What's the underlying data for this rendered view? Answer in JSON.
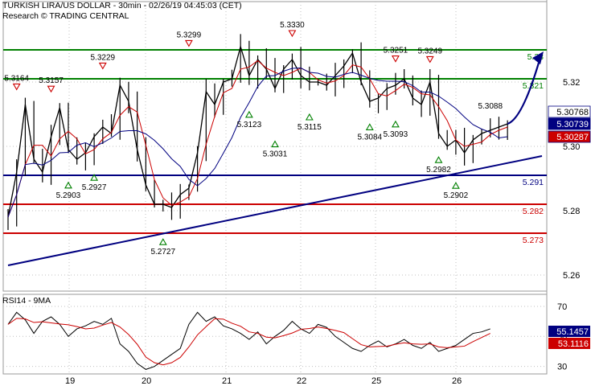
{
  "header": {
    "line1": "TURKISH LIRA/US DOLLAR - 30min - 02/26/19 04:45:03 (CET)",
    "line2": "Research © TRADING CENTRAL"
  },
  "chart_data": [
    {
      "type": "line",
      "title": "TURKISH LIRA/US DOLLAR - 30min",
      "x_ticks": [
        "19",
        "20",
        "21",
        "22",
        "25",
        "26"
      ],
      "ylim": [
        5.255,
        5.345
      ],
      "y_ticks": [
        "5.26",
        "5.28",
        "5.30",
        "5.32"
      ],
      "grid": true,
      "series_points": [
        [
          0,
          5.278
        ],
        [
          1,
          5.292
        ],
        [
          2,
          5.313
        ],
        [
          3,
          5.296
        ],
        [
          4,
          5.292
        ],
        [
          5,
          5.303
        ],
        [
          6,
          5.312
        ],
        [
          7,
          5.299
        ],
        [
          8,
          5.296
        ],
        [
          9,
          5.298
        ],
        [
          10,
          5.303
        ],
        [
          11,
          5.306
        ],
        [
          12,
          5.304
        ],
        [
          13,
          5.319
        ],
        [
          14,
          5.314
        ],
        [
          15,
          5.299
        ],
        [
          16,
          5.288
        ],
        [
          17,
          5.282
        ],
        [
          18,
          5.282
        ],
        [
          19,
          5.281
        ],
        [
          20,
          5.285
        ],
        [
          21,
          5.287
        ],
        [
          22,
          5.298
        ],
        [
          23,
          5.317
        ],
        [
          24,
          5.313
        ],
        [
          25,
          5.32
        ],
        [
          26,
          5.321
        ],
        [
          27,
          5.331
        ],
        [
          28,
          5.322
        ],
        [
          29,
          5.327
        ],
        [
          30,
          5.324
        ],
        [
          31,
          5.318
        ],
        [
          32,
          5.324
        ],
        [
          33,
          5.327
        ],
        [
          34,
          5.322
        ],
        [
          35,
          5.32
        ],
        [
          36,
          5.32
        ],
        [
          37,
          5.319
        ],
        [
          38,
          5.322
        ],
        [
          39,
          5.325
        ],
        [
          40,
          5.329
        ],
        [
          41,
          5.32
        ],
        [
          42,
          5.314
        ],
        [
          43,
          5.315
        ],
        [
          44,
          5.318
        ],
        [
          45,
          5.319
        ],
        [
          46,
          5.321
        ],
        [
          47,
          5.315
        ],
        [
          48,
          5.313
        ],
        [
          49,
          5.32
        ],
        [
          50,
          5.304
        ],
        [
          51,
          5.3
        ],
        [
          52,
          5.302
        ],
        [
          53,
          5.298
        ],
        [
          54,
          5.302
        ],
        [
          55,
          5.304
        ],
        [
          56,
          5.305
        ],
        [
          57,
          5.306
        ],
        [
          58,
          5.307
        ]
      ],
      "moving_averages": [
        "red",
        "navy"
      ],
      "levels": [
        {
          "label": "5.33",
          "value": 5.33,
          "color": "#008000"
        },
        {
          "label": "5.321",
          "value": 5.321,
          "color": "#008000"
        },
        {
          "label": "5.291",
          "value": 5.291,
          "color": "#000080"
        },
        {
          "label": "5.282",
          "value": 5.282,
          "color": "#cc0000"
        },
        {
          "label": "5.273",
          "value": 5.273,
          "color": "#cc0000"
        }
      ],
      "trendline": {
        "from": [
          0,
          5.263
        ],
        "to": [
          62,
          5.297
        ],
        "color": "#000080"
      },
      "forecast_arrow": {
        "from": [
          58,
          5.307
        ],
        "to": [
          62,
          5.329
        ],
        "color": "#000080"
      },
      "price_tags": [
        {
          "label": "5.30768",
          "value": 5.3077,
          "bg": "#ffffff",
          "fg": "#000000"
        },
        {
          "label": "5.30739",
          "value": 5.3074,
          "bg": "#000080",
          "fg": "#ffffff"
        },
        {
          "label": "5.30287",
          "value": 5.3029,
          "bg": "#cc0000",
          "fg": "#ffffff"
        }
      ],
      "peaks": [
        {
          "label": "5.3164",
          "x": 1,
          "y": 5.3164
        },
        {
          "label": "5.3157",
          "x": 5,
          "y": 5.3157
        },
        {
          "label": "5.3229",
          "x": 11,
          "y": 5.3229
        },
        {
          "label": "5.3299",
          "x": 21,
          "y": 5.3299
        },
        {
          "label": "5.3330",
          "x": 33,
          "y": 5.333
        },
        {
          "label": "5.3251",
          "x": 45,
          "y": 5.3251
        },
        {
          "label": "5.3249",
          "x": 49,
          "y": 5.3249
        }
      ],
      "troughs": [
        {
          "label": "5.2903",
          "x": 7,
          "y": 5.2903
        },
        {
          "label": "5.2927",
          "x": 10,
          "y": 5.2927
        },
        {
          "label": "5.2727",
          "x": 18,
          "y": 5.2727
        },
        {
          "label": "5.3123",
          "x": 28,
          "y": 5.3123
        },
        {
          "label": "5.3031",
          "x": 31,
          "y": 5.3031
        },
        {
          "label": "5.3115",
          "x": 35,
          "y": 5.3115
        },
        {
          "label": "5.3084",
          "x": 42,
          "y": 5.3084
        },
        {
          "label": "5.3093",
          "x": 45,
          "y": 5.3093
        },
        {
          "label": "5.2982",
          "x": 50,
          "y": 5.2982
        },
        {
          "label": "5.2902",
          "x": 52,
          "y": 5.2902
        }
      ],
      "target_label": {
        "label": "5.3088",
        "x": 56,
        "y": 5.3088
      }
    },
    {
      "type": "line",
      "title": "RSI14 - 9MA",
      "ylim": [
        25,
        78
      ],
      "y_ticks": [
        "30",
        "50",
        "70"
      ],
      "series_points": [
        [
          0,
          58
        ],
        [
          1,
          66
        ],
        [
          2,
          61
        ],
        [
          3,
          52
        ],
        [
          4,
          60
        ],
        [
          5,
          63
        ],
        [
          6,
          58
        ],
        [
          7,
          50
        ],
        [
          8,
          55
        ],
        [
          9,
          57
        ],
        [
          10,
          60
        ],
        [
          11,
          58
        ],
        [
          12,
          62
        ],
        [
          13,
          45
        ],
        [
          14,
          40
        ],
        [
          15,
          32
        ],
        [
          16,
          28
        ],
        [
          17,
          30
        ],
        [
          18,
          34
        ],
        [
          19,
          38
        ],
        [
          20,
          42
        ],
        [
          21,
          58
        ],
        [
          22,
          66
        ],
        [
          23,
          60
        ],
        [
          24,
          63
        ],
        [
          25,
          57
        ],
        [
          26,
          55
        ],
        [
          27,
          52
        ],
        [
          28,
          48
        ],
        [
          29,
          53
        ],
        [
          30,
          45
        ],
        [
          31,
          50
        ],
        [
          32,
          54
        ],
        [
          33,
          60
        ],
        [
          34,
          55
        ],
        [
          35,
          52
        ],
        [
          36,
          58
        ],
        [
          37,
          56
        ],
        [
          38,
          50
        ],
        [
          39,
          46
        ],
        [
          40,
          42
        ],
        [
          41,
          40
        ],
        [
          42,
          44
        ],
        [
          43,
          47
        ],
        [
          44,
          43
        ],
        [
          45,
          45
        ],
        [
          46,
          48
        ],
        [
          47,
          44
        ],
        [
          48,
          42
        ],
        [
          49,
          46
        ],
        [
          50,
          40
        ],
        [
          51,
          42
        ],
        [
          52,
          44
        ],
        [
          53,
          48
        ],
        [
          54,
          52
        ],
        [
          55,
          53
        ],
        [
          56,
          55
        ]
      ],
      "ma_color": "#cc0000",
      "price_tags": [
        {
          "label": "55.1457",
          "value": 55.1457,
          "bg": "#000080",
          "fg": "#ffffff"
        },
        {
          "label": "53.1116",
          "value": 53.1116,
          "bg": "#cc0000",
          "fg": "#ffffff"
        }
      ]
    }
  ]
}
